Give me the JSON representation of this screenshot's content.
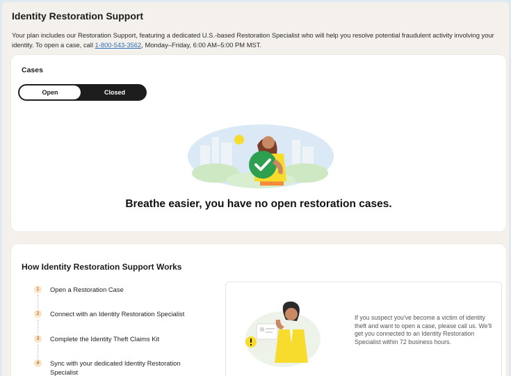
{
  "page": {
    "title": "Identity Restoration Support",
    "intro_before_phone": "Your plan includes our Restoration Support, featuring a dedicated U.S.-based Restoration Specialist who will help you resolve potential fraudulent activity involving your identity. To open a case, call ",
    "phone": "1-800-543-3562",
    "intro_after_phone": ", Monday–Friday, 6:00 AM–5:00 PM MST."
  },
  "cases": {
    "title": "Cases",
    "toggle": {
      "open_label": "Open",
      "closed_label": "Closed",
      "selected": "Open"
    },
    "empty_message": "Breathe easier, you have no open restoration cases."
  },
  "how_it_works": {
    "title": "How Identity Restoration Support Works",
    "steps": [
      {
        "num": "1",
        "label": "Open a Restoration Case"
      },
      {
        "num": "2",
        "label": "Connect with an Identity Restoration Specialist"
      },
      {
        "num": "3",
        "label": "Complete the Identity Theft Claims Kit"
      },
      {
        "num": "4",
        "label": "Sync with your dedicated Identity Restoration Specialist"
      }
    ],
    "info_text": "If you suspect you've become a victim of identity theft and want to open a case, please call us. We'll get you connected to an Identity Restoration Specialist within 72 business hours."
  },
  "colors": {
    "page_bg": "#f4f1ec",
    "toggle_bg": "#1d1d1d",
    "link": "#2f6fb3",
    "check_green": "#2e9e4f",
    "accent_yellow": "#f7dc2e"
  },
  "icons": [
    "check-icon",
    "warning-icon"
  ]
}
